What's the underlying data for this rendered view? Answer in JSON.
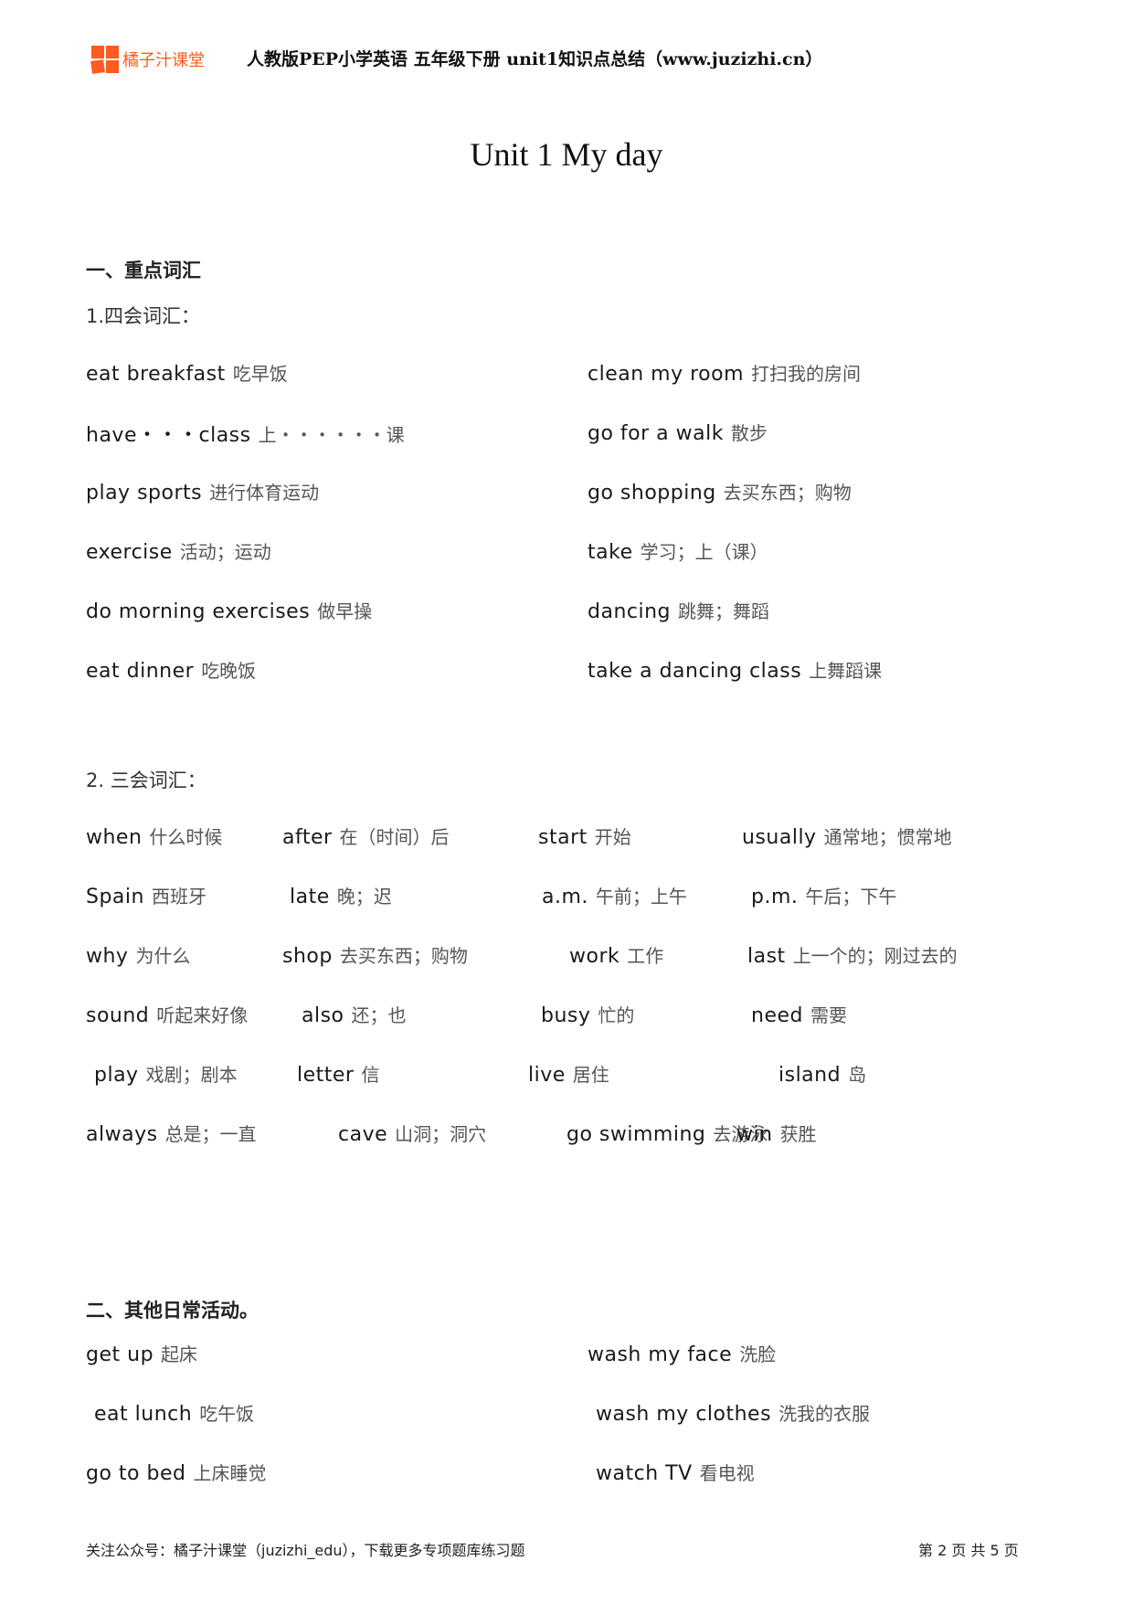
{
  "header": {
    "brand": "橘子汁课堂",
    "doc_title": "人教版PEP小学英语 五年级下册  unit1知识点总结（www.juzizhi.cn）",
    "brand_color": "#ff5a1f"
  },
  "title": "Unit 1 My day",
  "section1": {
    "heading": "一、重点词汇",
    "sub1": {
      "heading": "1.四会词汇：",
      "left": [
        {
          "en": "eat breakfast",
          "zh": "吃早饭"
        },
        {
          "en": "have・・・class",
          "zh": "上・・・・・・课"
        },
        {
          "en": " play  sports",
          "zh": "进行体育运动"
        },
        {
          "en": "exercise",
          "zh": "活动；运动"
        },
        {
          "en": "do  morning exercises",
          "zh": "做早操"
        },
        {
          "en": "eat dinner",
          "zh": "吃晚饭"
        }
      ],
      "right": [
        {
          "en": " clean my room",
          "zh": "打扫我的房间"
        },
        {
          "en": "go for a walk",
          "zh": "散步"
        },
        {
          "en": "go shopping",
          "zh": "去买东西；购物"
        },
        {
          "en": "take",
          "zh": "学习；上（课）"
        },
        {
          "en": "dancing",
          "zh": "跳舞；舞蹈"
        },
        {
          "en": "take a dancing class",
          "zh": "上舞蹈课"
        }
      ]
    },
    "sub2": {
      "heading": "2. 三会词汇：",
      "rows": [
        [
          {
            "en": "when",
            "zh": "什么时候"
          },
          {
            "en": "after",
            "zh": "在（时间）后"
          },
          {
            "en": "start",
            "zh": "开始"
          },
          {
            "en": "usually",
            "zh": "通常地；惯常地"
          }
        ],
        [
          {
            "en": "Spain",
            "zh": "西班牙"
          },
          {
            "en": "late",
            "zh": "晚；迟"
          },
          {
            "en": "a.m.",
            "zh": "午前；上午"
          },
          {
            "en": "p.m.",
            "zh": "午后；下午"
          }
        ],
        [
          {
            "en": "why",
            "zh": "为什么"
          },
          {
            "en": "shop",
            "zh": "去买东西；购物"
          },
          {
            "en": "work",
            "zh": "工作"
          },
          {
            "en": "last",
            "zh": "上一个的；刚过去的"
          }
        ],
        [
          {
            "en": "sound",
            "zh": "听起来好像"
          },
          {
            "en": "also",
            "zh": "还；也"
          },
          {
            "en": "busy",
            "zh": "忙的"
          },
          {
            "en": "need",
            "zh": "需要"
          }
        ],
        [
          {
            "en": "play",
            "zh": "戏剧；剧本"
          },
          {
            "en": "letter",
            "zh": "信"
          },
          {
            "en": "live",
            "zh": "居住"
          },
          {
            "en": "island",
            "zh": "岛"
          }
        ],
        [
          {
            "en": "always",
            "zh": "总是；一直"
          },
          {
            "en": "cave",
            "zh": "山洞；洞穴"
          },
          {
            "en": "go swimming",
            "zh": "去游泳"
          },
          {
            "en": "win",
            "zh": "获胜"
          }
        ]
      ]
    }
  },
  "section2": {
    "heading": "二、其他日常活动。",
    "left": [
      {
        "en": "get up",
        "zh": "起床"
      },
      {
        "en": "eat lunch",
        "zh": "吃午饭"
      },
      {
        "en": "go to bed",
        "zh": "上床睡觉"
      }
    ],
    "right": [
      {
        "en": "wash my face",
        "zh": "洗脸"
      },
      {
        "en": "wash my clothes",
        "zh": "洗我的衣服"
      },
      {
        "en": "watch TV",
        "zh": "看电视"
      }
    ]
  },
  "footer": {
    "left": "关注公众号：橘子汁课堂（juzizhi_edu），下载更多专项题库练习题",
    "page": "第 2 页 共 5 页"
  }
}
